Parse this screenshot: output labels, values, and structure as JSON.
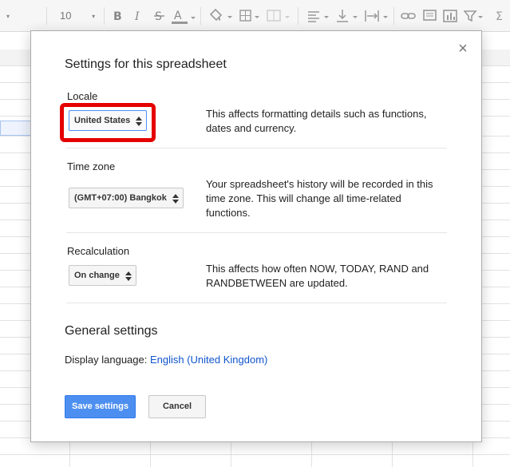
{
  "toolbar": {
    "font_size": "10",
    "font_size_caret": "▾",
    "icons": [
      "bold-icon",
      "italic-icon",
      "strikethrough-icon",
      "text-color-icon",
      "fill-color-icon",
      "borders-icon",
      "merge-cells-icon",
      "align-icon",
      "valign-icon",
      "text-wrap-icon",
      "link-icon",
      "comment-icon",
      "chart-icon",
      "filter-icon",
      "functions-icon"
    ]
  },
  "dialog": {
    "title": "Settings for this spreadsheet",
    "close_glyph": "×",
    "locale": {
      "label": "Locale",
      "value": "United States",
      "description": "This affects formatting details such as functions, dates and currency."
    },
    "timezone": {
      "label": "Time zone",
      "value": "(GMT+07:00) Bangkok",
      "description": "Your spreadsheet's history will be recorded in this time zone. This will change all time-related functions."
    },
    "recalculation": {
      "label": "Recalculation",
      "value": "On change",
      "description": "This affects how often NOW, TODAY, RAND and RANDBETWEEN are updated."
    },
    "general": {
      "title": "General settings",
      "display_language_label": "Display language: ",
      "display_language_value": "English (United Kingdom)"
    },
    "buttons": {
      "save": "Save settings",
      "cancel": "Cancel"
    }
  },
  "colors": {
    "accent": "#4d8ff0",
    "link": "#1155cc",
    "highlight": "#e50000"
  }
}
